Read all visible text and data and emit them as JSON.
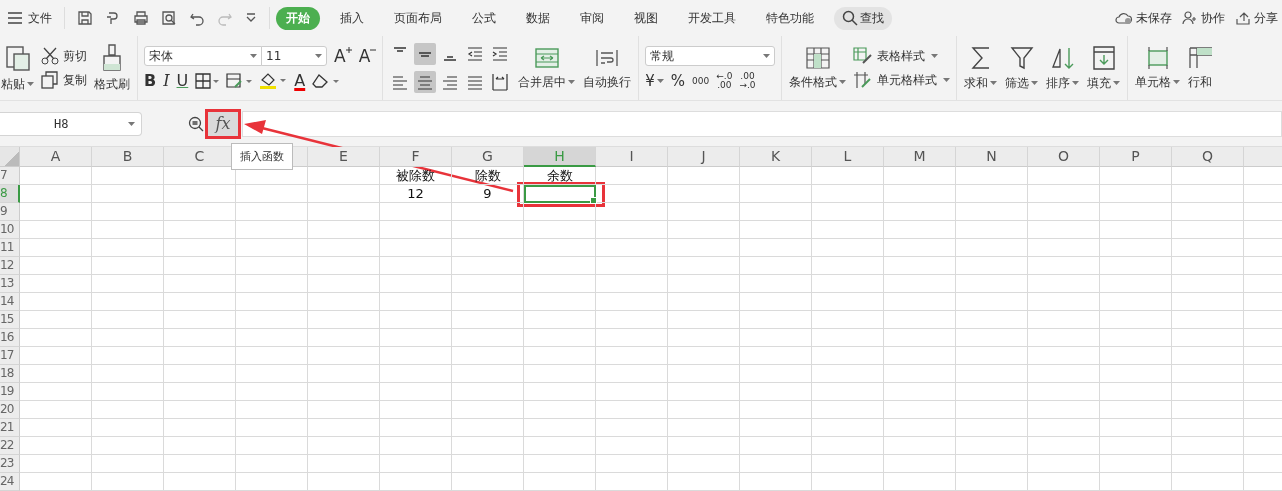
{
  "menu": {
    "label": "文件"
  },
  "tabs": [
    {
      "label": "开始",
      "selected": true
    },
    {
      "label": "插入",
      "selected": false
    },
    {
      "label": "页面布局",
      "selected": false
    },
    {
      "label": "公式",
      "selected": false
    },
    {
      "label": "数据",
      "selected": false
    },
    {
      "label": "审阅",
      "selected": false
    },
    {
      "label": "视图",
      "selected": false
    },
    {
      "label": "开发工具",
      "selected": false
    },
    {
      "label": "特色功能",
      "selected": false
    }
  ],
  "search": {
    "label": "查找"
  },
  "actions": [
    "未保存",
    "协作",
    "分享"
  ],
  "ribbon": {
    "paste": "粘贴",
    "cut": "剪切",
    "copy": "复制",
    "format_painter": "格式刷",
    "font": "宋体",
    "font_size": "11",
    "font_grow": "A",
    "font_shrink": "A",
    "bold": "B",
    "italic": "I",
    "underline": "U",
    "font_color": "A",
    "merge": "合并居中",
    "wrap": "自动换行",
    "number_format": "常规",
    "currency": "¥",
    "percent": "%",
    "comma": "000",
    "decimal_increase": [
      "←.0",
      ".00"
    ],
    "decimal_decrease": [
      ".00",
      "→.0"
    ],
    "conditional_format": "条件格式",
    "table_style": "表格样式",
    "cell_style": "单元格样式",
    "sum": "求和",
    "filter": "筛选",
    "sort": "排序",
    "fill": "填充",
    "cells": "单元格",
    "rows_cols": "行和"
  },
  "formula_bar": {
    "name_box": "H8",
    "function_button": "fx",
    "tooltip": "插入函数"
  },
  "sheet": {
    "columns": [
      {
        "label": "A",
        "selected": false
      },
      {
        "label": "B",
        "selected": false
      },
      {
        "label": "C",
        "selected": false
      },
      {
        "selected": false
      },
      {
        "label": "E",
        "selected": false
      },
      {
        "label": "F",
        "selected": false
      },
      {
        "label": "G",
        "selected": false
      },
      {
        "label": "H",
        "selected": true
      },
      {
        "label": "I",
        "selected": false
      },
      {
        "label": "J",
        "selected": false
      },
      {
        "label": "K",
        "selected": false
      },
      {
        "label": "L",
        "selected": false
      },
      {
        "label": "M",
        "selected": false
      },
      {
        "label": "N",
        "selected": false
      },
      {
        "label": "O",
        "selected": false
      },
      {
        "label": "P",
        "selected": false
      },
      {
        "label": "Q",
        "selected": false
      },
      {
        "selected": false
      }
    ],
    "rows": [
      {
        "label": "7",
        "selected": false,
        "cells": [
          null,
          null,
          null,
          null,
          null,
          "被除数",
          "除数",
          "余数",
          null,
          null,
          null,
          null,
          null,
          null,
          null,
          null,
          null,
          null
        ]
      },
      {
        "label": "8",
        "selected": true,
        "cells": [
          null,
          null,
          null,
          null,
          null,
          "12",
          "9",
          null,
          null,
          null,
          null,
          null,
          null,
          null,
          null,
          null,
          null,
          null
        ]
      },
      {
        "label": "9",
        "selected": false
      },
      {
        "label": "10",
        "selected": false
      },
      {
        "label": "11",
        "selected": false
      },
      {
        "label": "12",
        "selected": false
      },
      {
        "label": "13",
        "selected": false
      },
      {
        "label": "14",
        "selected": false
      },
      {
        "label": "15",
        "selected": false
      },
      {
        "label": "16",
        "selected": false
      },
      {
        "label": "17",
        "selected": false
      },
      {
        "label": "18",
        "selected": false
      },
      {
        "label": "19",
        "selected": false
      },
      {
        "label": "20",
        "selected": false
      },
      {
        "label": "21",
        "selected": false
      },
      {
        "label": "22",
        "selected": false
      },
      {
        "label": "23",
        "selected": false
      },
      {
        "label": "24",
        "selected": false
      }
    ]
  }
}
